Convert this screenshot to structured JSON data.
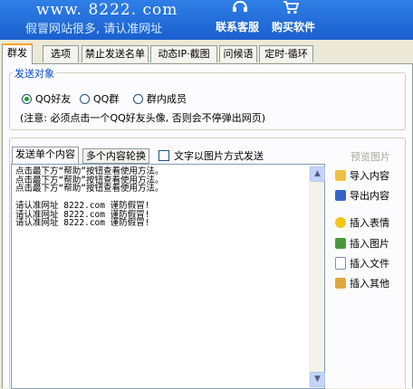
{
  "header": {
    "site_url": "www. 8222. com",
    "tagline": "假冒网站很多, 请认准网址",
    "contact": "联系客服",
    "buy": "购买软件",
    "icons": [
      "headset-icon",
      "cart-icon"
    ]
  },
  "tabs": [
    {
      "label": "群发",
      "active": true
    },
    {
      "label": "选项",
      "active": false
    },
    {
      "label": "禁止发送名单",
      "active": false
    },
    {
      "label": "动态IP·截图",
      "active": false
    },
    {
      "label": "问候语",
      "active": false
    },
    {
      "label": "定时·循环",
      "active": false
    }
  ],
  "target": {
    "title": "发送对象",
    "options": [
      {
        "label": "QQ好友",
        "selected": true
      },
      {
        "label": "QQ群",
        "selected": false
      },
      {
        "label": "群内成员",
        "selected": false
      }
    ],
    "note": "(注意: 必须点击一个QQ好友头像, 否则会不停弹出网页)"
  },
  "content": {
    "subtabs": [
      {
        "label": "发送单个内容",
        "active": true
      },
      {
        "label": "多个内容轮换",
        "active": false
      }
    ],
    "image_mode_label": "文字以图片方式发送",
    "image_mode_checked": false,
    "lines": [
      "点击最下方“帮助”按钮查看使用方法。",
      "点击最下方“帮助”按钮查看使用方法。",
      "点击最下方“帮助”按钮查看使用方法。",
      "",
      "请认准网址 8222.com 谨防假冒!",
      "请认准网址 8222.com 谨防假冒!",
      "请认准网址 8222.com 谨防假冒!"
    ]
  },
  "side": {
    "preview": "预览图片",
    "import": "导入内容",
    "export": "导出内容",
    "emoji": "插入表情",
    "image": "插入图片",
    "file": "插入文件",
    "other": "插入其他"
  },
  "scroll": {
    "up": "▲",
    "down": "▼"
  }
}
